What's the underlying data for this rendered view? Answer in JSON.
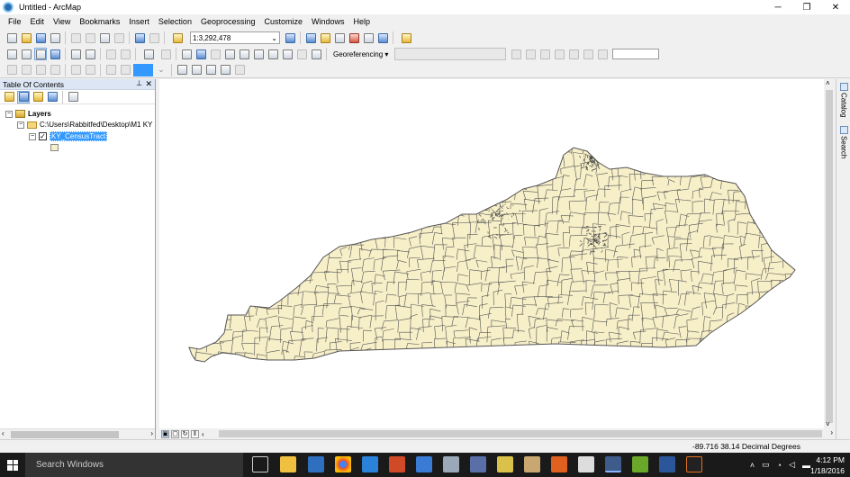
{
  "window": {
    "title": "Untitled - ArcMap",
    "minimize": "─",
    "maximize": "❐",
    "close": "✕"
  },
  "menu": [
    "File",
    "Edit",
    "View",
    "Bookmarks",
    "Insert",
    "Selection",
    "Geoprocessing",
    "Customize",
    "Windows",
    "Help"
  ],
  "toolbar": {
    "scale": "1:3,292,478",
    "georeferencing_label": "Georeferencing ▾",
    "georef_layer": ""
  },
  "toc": {
    "title": "Table Of Contents",
    "pin": "⊥",
    "close": "✕",
    "layers_label": "Layers",
    "folder_path": "C:\\Users\\Rabbitfed\\Desktop\\M1 KY",
    "layer_name": "KY_CensusTract",
    "layer_checked": true
  },
  "map": {
    "fill_color": "#f7efc8",
    "outline_color": "#555555"
  },
  "status": {
    "coordinates": "-89.716  38.14 Decimal Degrees"
  },
  "taskbar": {
    "search_placeholder": "Search Windows",
    "time": "4:12 PM",
    "date": "1/18/2016"
  }
}
